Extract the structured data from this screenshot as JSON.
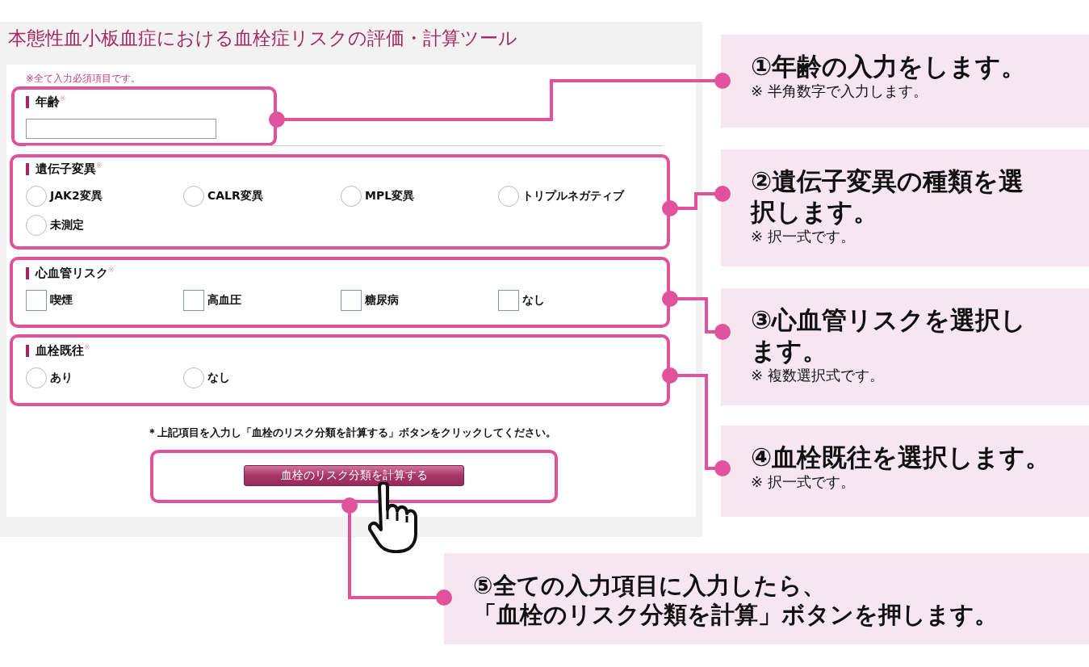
{
  "title": "本態性血小板血症における血栓症リスクの評価・計算ツール",
  "required_note": "※全て入力必須項目です。",
  "sections": [
    {
      "kind": "text",
      "label": "年齢",
      "required_mark": "※"
    },
    {
      "kind": "radio",
      "label": "遺伝子変異",
      "required_mark": "※",
      "options": [
        {
          "label": "JAK2変異",
          "selected": false
        },
        {
          "label": "CALR変異",
          "selected": false
        },
        {
          "label": "MPL変異",
          "selected": false
        },
        {
          "label": "トリプルネガティブ",
          "selected": false
        },
        {
          "label": "未測定",
          "selected": false
        }
      ]
    },
    {
      "kind": "checkbox",
      "label": "心血管リスク",
      "required_mark": "※",
      "options": [
        {
          "label": "喫煙",
          "checked": false
        },
        {
          "label": "高血圧",
          "checked": false
        },
        {
          "label": "糖尿病",
          "checked": false
        },
        {
          "label": "なし",
          "checked": false
        }
      ]
    },
    {
      "kind": "radio",
      "label": "血栓既往",
      "required_mark": "※",
      "options": [
        {
          "label": "あり",
          "selected": false
        },
        {
          "label": "なし",
          "selected": false
        }
      ]
    }
  ],
  "instruction": "＊上記項目を入力し「血栓のリスク分類を計算する」ボタンをクリックしてください。",
  "button": "血栓のリスク分類を計算する",
  "annotations": [
    {
      "lines": [
        "①年齢の入力をします。"
      ],
      "note": "※ 半角数字で入力します。"
    },
    {
      "lines": [
        "②遺伝子変異の種類を選",
        "択します。"
      ],
      "note": "※ 択一式です。"
    },
    {
      "lines": [
        "③心血管リスクを選択し",
        "ます。"
      ],
      "note": "※ 複数選択式です。"
    },
    {
      "lines": [
        "④血栓既往を選択します。"
      ],
      "note": "※ 択一式です。"
    }
  ],
  "final_annotation": {
    "lines": [
      "⑤全ての入力項目に入力したら、",
      "「血栓のリスク分類を計算」ボタンを押します。"
    ]
  }
}
